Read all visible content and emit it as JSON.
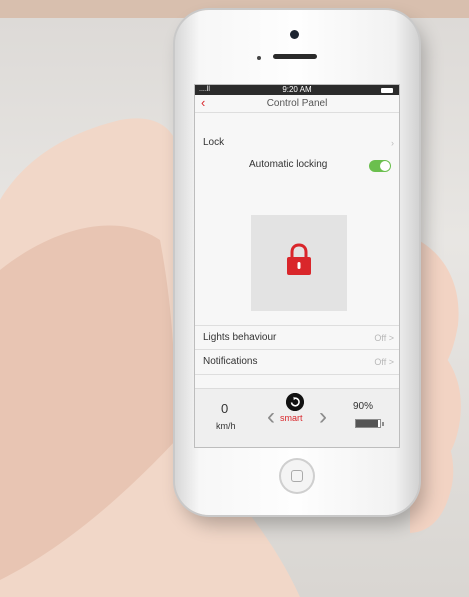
{
  "status_bar": {
    "time": "9:20 AM",
    "signal": "....ll"
  },
  "nav": {
    "title": "Control Panel",
    "back_icon": "chevron-left-icon"
  },
  "lock": {
    "label": "Lock",
    "automatic_locking_label": "Automatic locking",
    "automatic_locking_on": true,
    "icon": "padlock-icon",
    "accent_color": "#d9262b",
    "toggle_color": "#6bbf4e"
  },
  "settings": [
    {
      "label": "Lights behaviour",
      "value": "Off >"
    },
    {
      "label": "Notifications",
      "value": "Off >"
    }
  ],
  "dashboard": {
    "speed_value": "0",
    "speed_unit": "km/h",
    "mode_label": "smart",
    "mode_prev_icon": "chevron-left-icon",
    "mode_next_icon": "chevron-right-icon",
    "mode_icon": "refresh-icon",
    "battery_label": "90%",
    "battery_level": 0.9
  }
}
